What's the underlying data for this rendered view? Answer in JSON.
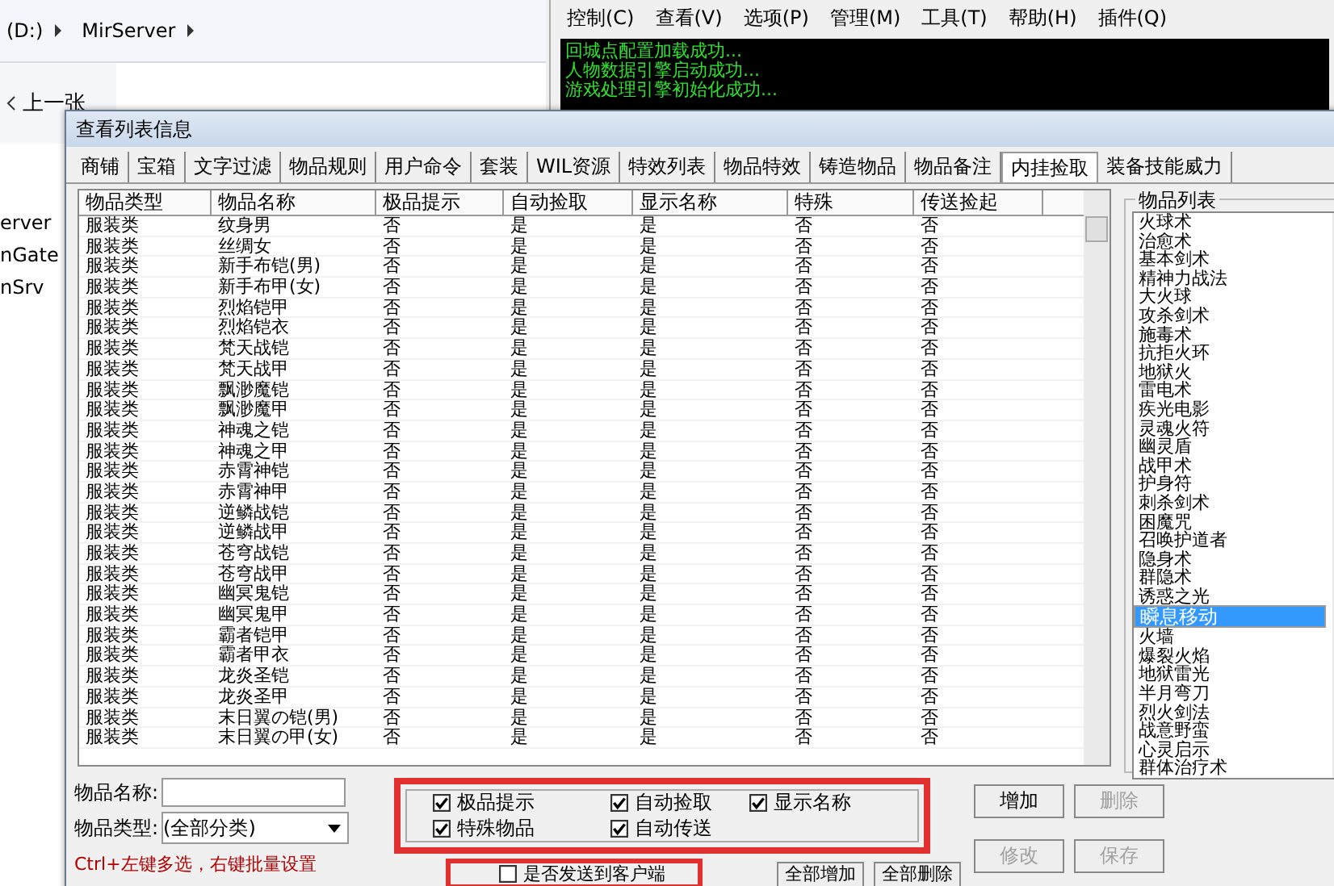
{
  "explorer": {
    "breadcrumb": [
      "(D:)",
      "MirServer"
    ],
    "back_button": "上一张",
    "side_items": [
      "erver",
      "nGate",
      "nSrv"
    ]
  },
  "console": {
    "menu": [
      "控制(C)",
      "查看(V)",
      "选项(P)",
      "管理(M)",
      "工具(T)",
      "帮助(H)",
      "插件(Q)"
    ],
    "log": [
      "回城点配置加载成功...",
      "人物数据引擎启动成功...",
      "游戏处理引擎初始化成功..."
    ]
  },
  "dialog": {
    "title": "查看列表信息",
    "tabs": [
      {
        "label": "商铺",
        "selected": false
      },
      {
        "label": "宝箱",
        "selected": false
      },
      {
        "label": "文字过滤",
        "selected": false
      },
      {
        "label": "物品规则",
        "selected": false
      },
      {
        "label": "用户命令",
        "selected": false
      },
      {
        "label": "套装",
        "selected": false
      },
      {
        "label": "WIL资源",
        "selected": false
      },
      {
        "label": "特效列表",
        "selected": false
      },
      {
        "label": "物品特效",
        "selected": false
      },
      {
        "label": "铸造物品",
        "selected": false
      },
      {
        "label": "物品备注",
        "selected": false
      },
      {
        "label": "内挂捡取",
        "selected": true
      },
      {
        "label": "装备技能威力",
        "selected": false
      }
    ],
    "table": {
      "columns": [
        "物品类型",
        "物品名称",
        "极品提示",
        "自动捡取",
        "显示名称",
        "特殊",
        "传送捡起"
      ],
      "rows": [
        {
          "cells": [
            "服装类",
            "纹身男",
            "否",
            "是",
            "是",
            "否",
            "否"
          ]
        },
        {
          "cells": [
            "服装类",
            "丝绸女",
            "否",
            "是",
            "是",
            "否",
            "否"
          ]
        },
        {
          "cells": [
            "服装类",
            "新手布铠(男)",
            "否",
            "是",
            "是",
            "否",
            "否"
          ]
        },
        {
          "cells": [
            "服装类",
            "新手布甲(女)",
            "否",
            "是",
            "是",
            "否",
            "否"
          ]
        },
        {
          "cells": [
            "服装类",
            "烈焰铠甲",
            "否",
            "是",
            "是",
            "否",
            "否"
          ]
        },
        {
          "cells": [
            "服装类",
            "烈焰铠衣",
            "否",
            "是",
            "是",
            "否",
            "否"
          ]
        },
        {
          "cells": [
            "服装类",
            "梵天战铠",
            "否",
            "是",
            "是",
            "否",
            "否"
          ]
        },
        {
          "cells": [
            "服装类",
            "梵天战甲",
            "否",
            "是",
            "是",
            "否",
            "否"
          ]
        },
        {
          "cells": [
            "服装类",
            "飘渺魔铠",
            "否",
            "是",
            "是",
            "否",
            "否"
          ]
        },
        {
          "cells": [
            "服装类",
            "飘渺魔甲",
            "否",
            "是",
            "是",
            "否",
            "否"
          ]
        },
        {
          "cells": [
            "服装类",
            "神魂之铠",
            "否",
            "是",
            "是",
            "否",
            "否"
          ]
        },
        {
          "cells": [
            "服装类",
            "神魂之甲",
            "否",
            "是",
            "是",
            "否",
            "否"
          ]
        },
        {
          "cells": [
            "服装类",
            "赤霄神铠",
            "否",
            "是",
            "是",
            "否",
            "否"
          ]
        },
        {
          "cells": [
            "服装类",
            "赤霄神甲",
            "否",
            "是",
            "是",
            "否",
            "否"
          ]
        },
        {
          "cells": [
            "服装类",
            "逆鳞战铠",
            "否",
            "是",
            "是",
            "否",
            "否"
          ]
        },
        {
          "cells": [
            "服装类",
            "逆鳞战甲",
            "否",
            "是",
            "是",
            "否",
            "否"
          ]
        },
        {
          "cells": [
            "服装类",
            "苍穹战铠",
            "否",
            "是",
            "是",
            "否",
            "否"
          ]
        },
        {
          "cells": [
            "服装类",
            "苍穹战甲",
            "否",
            "是",
            "是",
            "否",
            "否"
          ]
        },
        {
          "cells": [
            "服装类",
            "幽冥鬼铠",
            "否",
            "是",
            "是",
            "否",
            "否"
          ]
        },
        {
          "cells": [
            "服装类",
            "幽冥鬼甲",
            "否",
            "是",
            "是",
            "否",
            "否"
          ]
        },
        {
          "cells": [
            "服装类",
            "霸者铠甲",
            "否",
            "是",
            "是",
            "否",
            "否"
          ]
        },
        {
          "cells": [
            "服装类",
            "霸者甲衣",
            "否",
            "是",
            "是",
            "否",
            "否"
          ]
        },
        {
          "cells": [
            "服装类",
            "龙炎圣铠",
            "否",
            "是",
            "是",
            "否",
            "否"
          ]
        },
        {
          "cells": [
            "服装类",
            "龙炎圣甲",
            "否",
            "是",
            "是",
            "否",
            "否"
          ]
        },
        {
          "cells": [
            "服装类",
            "末日翼の铠(男)",
            "否",
            "是",
            "是",
            "否",
            "否"
          ]
        },
        {
          "cells": [
            "服装类",
            "末日翼の甲(女)",
            "否",
            "是",
            "是",
            "否",
            "否"
          ]
        }
      ]
    },
    "item_list": {
      "title": "物品列表",
      "items": [
        {
          "label": "火球术",
          "selected": false
        },
        {
          "label": "治愈术",
          "selected": false
        },
        {
          "label": "基本剑术",
          "selected": false
        },
        {
          "label": "精神力战法",
          "selected": false
        },
        {
          "label": "大火球",
          "selected": false
        },
        {
          "label": "攻杀剑术",
          "selected": false
        },
        {
          "label": "施毒术",
          "selected": false
        },
        {
          "label": "抗拒火环",
          "selected": false
        },
        {
          "label": "地狱火",
          "selected": false
        },
        {
          "label": "雷电术",
          "selected": false
        },
        {
          "label": "疾光电影",
          "selected": false
        },
        {
          "label": "灵魂火符",
          "selected": false
        },
        {
          "label": "幽灵盾",
          "selected": false
        },
        {
          "label": "战甲术",
          "selected": false
        },
        {
          "label": "护身符",
          "selected": false
        },
        {
          "label": "刺杀剑术",
          "selected": false
        },
        {
          "label": "困魔咒",
          "selected": false
        },
        {
          "label": "召唤护道者",
          "selected": false
        },
        {
          "label": "隐身术",
          "selected": false
        },
        {
          "label": "群隐术",
          "selected": false
        },
        {
          "label": "诱惑之光",
          "selected": false
        },
        {
          "label": "瞬息移动",
          "selected": true
        },
        {
          "label": "火墙",
          "selected": false
        },
        {
          "label": "爆裂火焰",
          "selected": false
        },
        {
          "label": "地狱雷光",
          "selected": false
        },
        {
          "label": "半月弯刀",
          "selected": false
        },
        {
          "label": "烈火剑法",
          "selected": false
        },
        {
          "label": "战意野蛮",
          "selected": false
        },
        {
          "label": "心灵启示",
          "selected": false
        },
        {
          "label": "群体治疗术",
          "selected": false
        }
      ]
    },
    "form": {
      "name_label": "物品名称:",
      "type_label": "物品类型:",
      "type_value": "(全部分类)"
    },
    "options": [
      {
        "label": "极品提示",
        "checked": true
      },
      {
        "label": "自动捡取",
        "checked": true
      },
      {
        "label": "显示名称",
        "checked": true
      },
      {
        "label": "特殊物品",
        "checked": true
      },
      {
        "label": "自动传送",
        "checked": true
      }
    ],
    "buttons": [
      {
        "label": "增加",
        "disabled": false
      },
      {
        "label": "删除",
        "disabled": true
      },
      {
        "label": "修改",
        "disabled": true
      },
      {
        "label": "保存",
        "disabled": true
      }
    ],
    "send_option": {
      "label": "是否发送到客户端",
      "checked": false
    },
    "hint": "Ctrl+左键多选，右键批量设置",
    "bulk_buttons": [
      "全部增加",
      "全部删除"
    ]
  }
}
